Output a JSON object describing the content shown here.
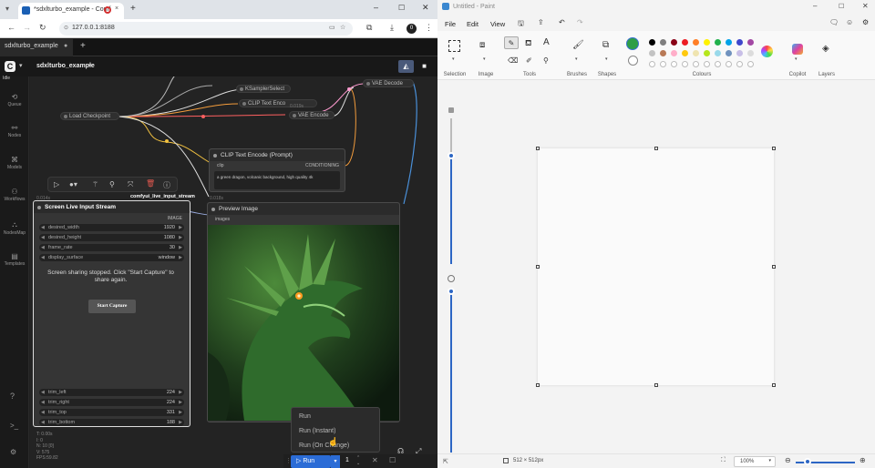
{
  "browser": {
    "tab_title": "*sdxlturbo_example - Comf",
    "new_tab": "+",
    "url": "127.0.0.1:8188",
    "ext_badge": "0"
  },
  "workflow": {
    "tab": "sdxlturbo_example",
    "add_tab": "+",
    "name": "sdxlturbo_example",
    "menu_chevron": "▾"
  },
  "sidebar": {
    "items": [
      "Queue",
      "Nodes",
      "Models",
      "Workflows",
      "NodesMap",
      "Templates"
    ]
  },
  "canvas": {
    "corner_label": "Idle",
    "stats": [
      "T: 0.00s",
      "I: 0",
      "N: 10 [0]",
      "V: 575",
      "FPS:59.82"
    ]
  },
  "pills": [
    "Load Checkpoint",
    "KSamplerSelect",
    "CLIP Text Enco",
    "VAE Encode",
    "VAE Decode"
  ],
  "clip_node": {
    "title": "CLIP Text Encode (Prompt)",
    "in_label": "clip",
    "out_label": "CONDITIONING",
    "text": "a green dragon, volcanic background, high quality 4k",
    "timing": "0.019s"
  },
  "screen_node": {
    "timing": "0.014s",
    "label": "comfyui_live_input_stream",
    "title": "Screen Live Input Stream",
    "output": "IMAGE",
    "widgets": [
      {
        "name": "desired_width",
        "value": "1920"
      },
      {
        "name": "desired_height",
        "value": "1080"
      },
      {
        "name": "frame_rate",
        "value": "30"
      },
      {
        "name": "display_surface",
        "value": "window"
      }
    ],
    "message": "Screen sharing stopped. Click \"Start Capture\" to share again.",
    "button": "Start Capture",
    "trims": [
      {
        "name": "trim_left",
        "value": "224"
      },
      {
        "name": "trim_right",
        "value": "224"
      },
      {
        "name": "trim_top",
        "value": "331"
      },
      {
        "name": "trim_bottom",
        "value": "188"
      }
    ]
  },
  "preview_node": {
    "timing": "0.018s",
    "title": "Preview Image",
    "input": "images"
  },
  "run_menu": {
    "items": [
      "Run",
      "Run (Instant)",
      "Run (On Change)"
    ]
  },
  "run_bar": {
    "run": "Run",
    "count": "1"
  },
  "paint": {
    "title": "Untitled - Paint",
    "menu": [
      "File",
      "Edit",
      "View"
    ],
    "groups": [
      "Selection",
      "Image",
      "Tools",
      "Brushes",
      "Shapes",
      "Colours",
      "Copilot",
      "Layers"
    ],
    "selected_color": "#2e9e46",
    "palette": [
      "#000000",
      "#7f7f7f",
      "#880015",
      "#ed1c24",
      "#ff7f27",
      "#fff200",
      "#22b14c",
      "#00a2e8",
      "#3f48cc",
      "#a349a4",
      "#c3c3c3",
      "#b97a57",
      "#ffaec9",
      "#ffc90e",
      "#efe4b0",
      "#b5e61d",
      "#99d9ea",
      "#7092be",
      "#c8bfe7",
      "#dcdcdc"
    ],
    "canvas_size": "512 × 512px",
    "zoom": "100%"
  }
}
